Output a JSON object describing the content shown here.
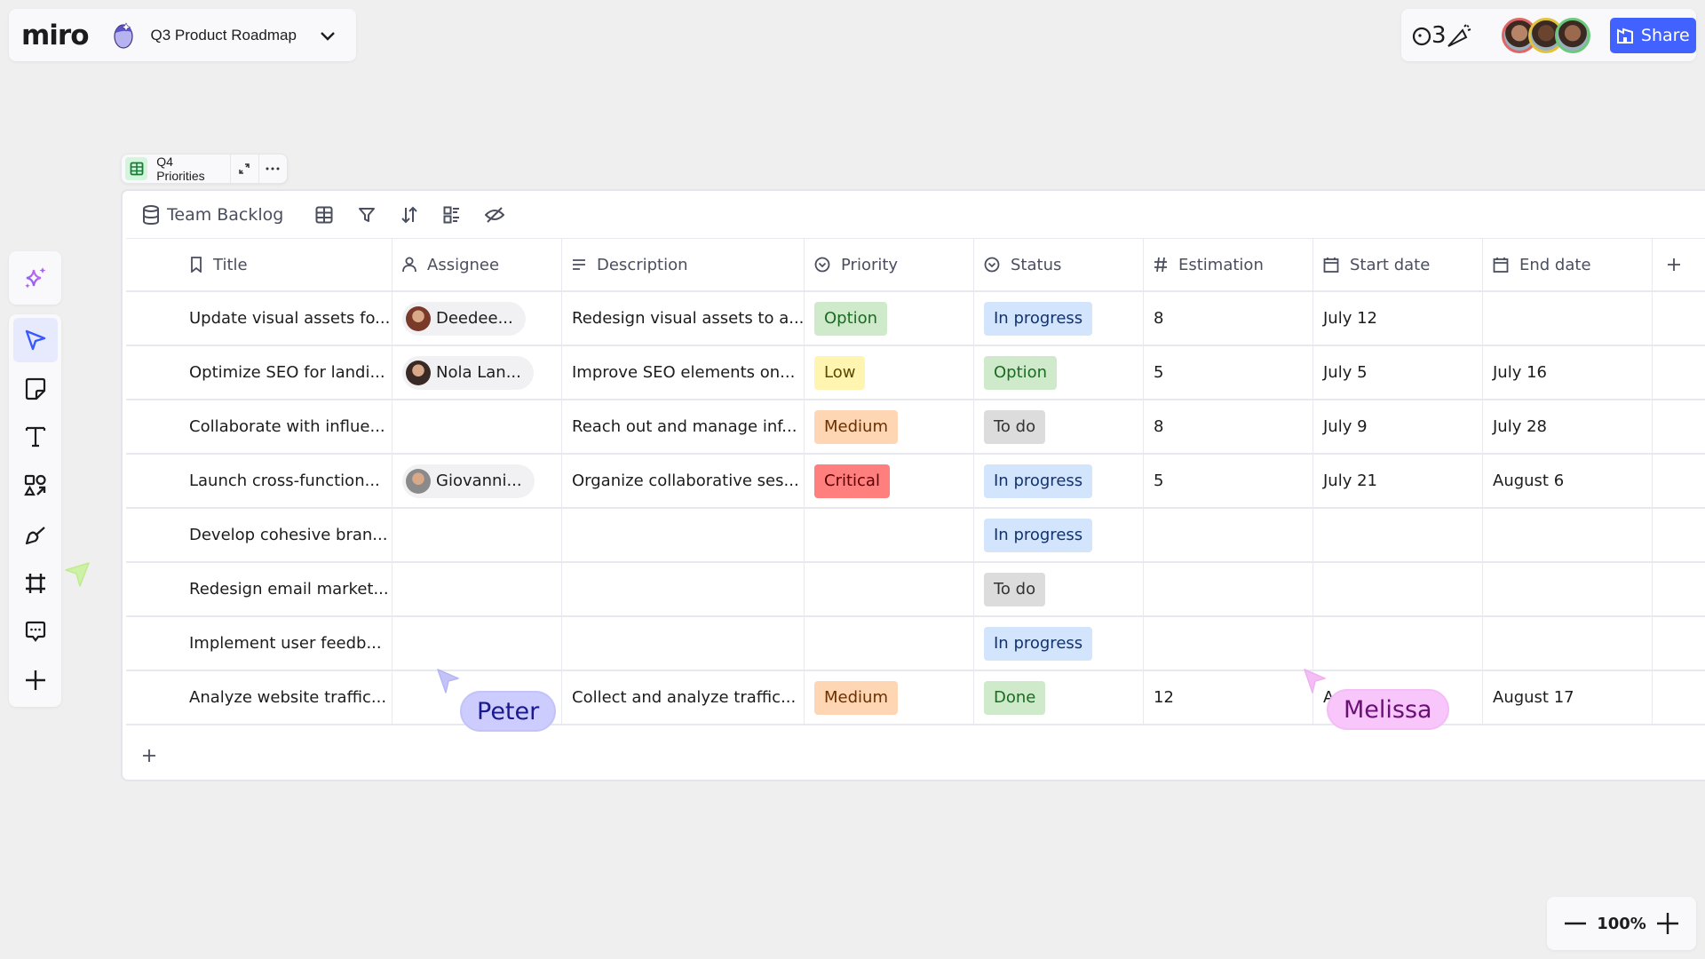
{
  "app": {
    "logo": "miro",
    "board_title": "Q3 Product Roadmap"
  },
  "collab": {
    "reaction_count": "3",
    "share_label": "Share",
    "avatars": [
      {
        "ring": "#e06666",
        "skin": "#b88468"
      },
      {
        "ring": "#e2c23b",
        "skin": "#6b4430"
      },
      {
        "ring": "#6bc97b",
        "skin": "#9b6a4e"
      }
    ]
  },
  "widget": {
    "tab_label": "Q4 Priorities",
    "table_title": "Team Backlog"
  },
  "table": {
    "columns": [
      "Title",
      "Assignee",
      "Description",
      "Priority",
      "Status",
      "Estimation",
      "Start date",
      "End date"
    ],
    "rows": [
      {
        "title": "Update visual assets fo...",
        "assignee": "Deedee...",
        "description": "Redesign visual assets to a...",
        "priority": "Option",
        "status": "In progress",
        "estimation": "8",
        "start": "July 12",
        "end": ""
      },
      {
        "title": "Optimize SEO for landi...",
        "assignee": "Nola Lan...",
        "description": "Improve SEO elements on...",
        "priority": "Low",
        "status": "Option",
        "estimation": "5",
        "start": "July 5",
        "end": "July 16"
      },
      {
        "title": "Collaborate with influe...",
        "assignee": "",
        "description": "Reach out and manage inf...",
        "priority": "Medium",
        "status": "To do",
        "estimation": "8",
        "start": "July 9",
        "end": "July 28"
      },
      {
        "title": "Launch cross-function...",
        "assignee": "Giovanni...",
        "description": "Organize collaborative ses...",
        "priority": "Critical",
        "status": "In progress",
        "estimation": "5",
        "start": "July 21",
        "end": "August 6"
      },
      {
        "title": "Develop cohesive bran...",
        "assignee": "",
        "description": "",
        "priority": "",
        "status": "In progress",
        "estimation": "",
        "start": "",
        "end": ""
      },
      {
        "title": "Redesign email market...",
        "assignee": "",
        "description": "",
        "priority": "",
        "status": "To do",
        "estimation": "",
        "start": "",
        "end": ""
      },
      {
        "title": "Implement user feedb...",
        "assignee": "",
        "description": "",
        "priority": "",
        "status": "In progress",
        "estimation": "",
        "start": "",
        "end": ""
      },
      {
        "title": "Analyze website traffic...",
        "assignee": "",
        "description": "Collect and analyze traffic...",
        "priority": "Medium",
        "status": "Done",
        "estimation": "12",
        "start": "A",
        "end": "August 17"
      }
    ]
  },
  "tag_colors": {
    "Option": {
      "bg": "#cfeacb",
      "fg": "#1b6a23"
    },
    "Low": {
      "bg": "#fff4b0",
      "fg": "#5a4a00"
    },
    "Medium": {
      "bg": "#ffd6b4",
      "fg": "#6a3000"
    },
    "Critical": {
      "bg": "#ff7e7e",
      "fg": "#5a0000"
    },
    "In progress": {
      "bg": "#d3e4fd",
      "fg": "#12336d"
    },
    "To do": {
      "bg": "#dcdcdc",
      "fg": "#333333"
    },
    "Done": {
      "bg": "#cfeacb",
      "fg": "#1b6a23"
    }
  },
  "cursors": [
    {
      "name": "Peter",
      "bg": "#ccccff",
      "fg": "#1a1a8c",
      "arrow": "#c3c3f8"
    },
    {
      "name": "Melissa",
      "bg": "#f8c6fa",
      "fg": "#6a0f76",
      "arrow": "#f4bdf6"
    }
  ],
  "zoom": {
    "level": "100%"
  }
}
